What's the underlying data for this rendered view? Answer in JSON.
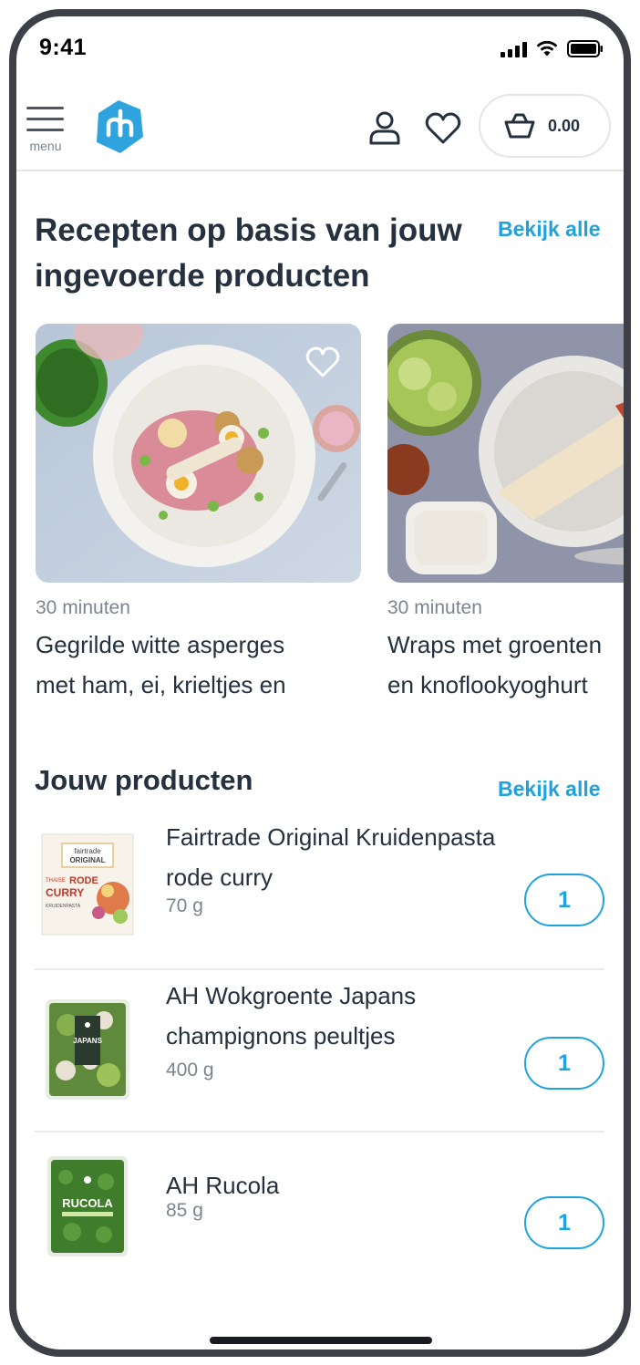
{
  "status_bar": {
    "time": "9:41"
  },
  "header": {
    "menu_label": "menu",
    "basket_total": "0.00"
  },
  "recipes_section": {
    "title_line1": "Recepten op basis van jouw",
    "title_line2": "ingevoerde producten",
    "view_all": "Bekijk alle",
    "cards": [
      {
        "time": "30 minuten",
        "title_line1": "Gegrilde witte asperges",
        "title_line2": "met ham, ei, krieltjes en"
      },
      {
        "time": "30 minuten",
        "title_line1": "Wraps met groenten",
        "title_line2": "en knoflookyoghurt"
      }
    ]
  },
  "products_section": {
    "title": "Jouw producten",
    "view_all": "Bekijk alle",
    "items": [
      {
        "name_line1": "Fairtrade Original Kruidenpasta",
        "name_line2": "rode curry",
        "size": "70 g",
        "quantity": "1",
        "package_text": [
          "fairtrade",
          "ORIGINAL",
          "THAISE",
          "RODE",
          "CURRY",
          "KRUIDENPASTA"
        ]
      },
      {
        "name_line1": "AH Wokgroente Japans",
        "name_line2": "champignons peultjes",
        "size": "400 g",
        "quantity": "1",
        "package_text": [
          "JAPANS"
        ]
      },
      {
        "name_line1": "AH Rucola",
        "name_line2": "",
        "size": "85 g",
        "quantity": "1",
        "package_text": [
          "RUCOLA"
        ]
      }
    ]
  },
  "colors": {
    "accent": "#1fa3de",
    "text": "#25313e",
    "muted": "#7b848e",
    "frame": "#3d4047"
  },
  "icons": [
    "menu-icon",
    "ah-logo",
    "user-icon",
    "heart-icon",
    "basket-icon"
  ]
}
